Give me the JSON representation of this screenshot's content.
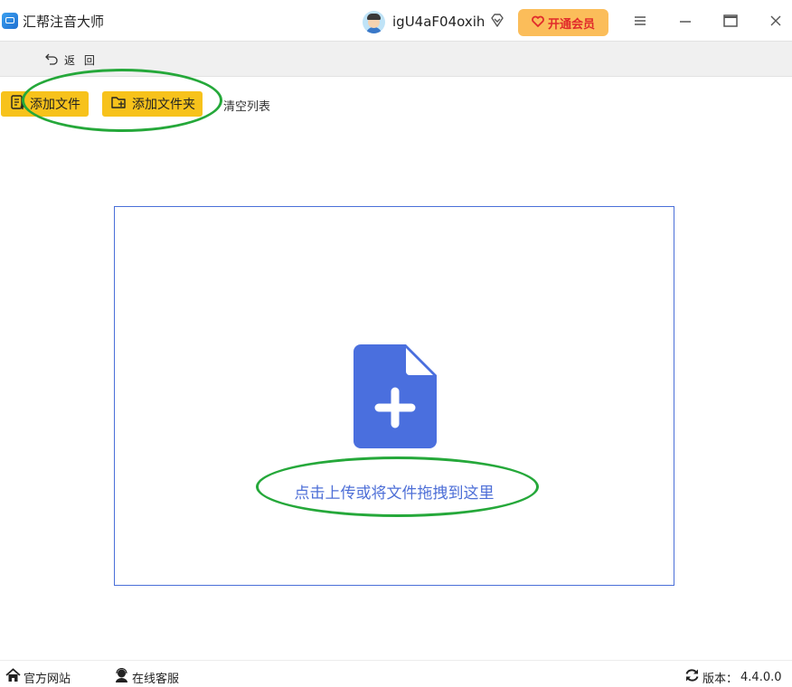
{
  "app": {
    "title": "汇帮注音大师"
  },
  "user": {
    "name": "igU4aF04oxih",
    "vip_button": "开通会员"
  },
  "nav": {
    "back_label": "返 回"
  },
  "toolbar": {
    "add_file": "添加文件",
    "add_folder": "添加文件夹",
    "clear_list": "清空列表"
  },
  "dropzone": {
    "hint": "点击上传或将文件拖拽到这里"
  },
  "footer": {
    "website": "官方网站",
    "support": "在线客服",
    "version_label": "版本：",
    "version": "4.4.0.0"
  },
  "colors": {
    "accent_yellow": "#f7c21b",
    "vip_bg": "#fbbd5a",
    "vip_text": "#e12b2b",
    "drop_blue": "#4a6fd8",
    "annotation_green": "#25a83a"
  }
}
